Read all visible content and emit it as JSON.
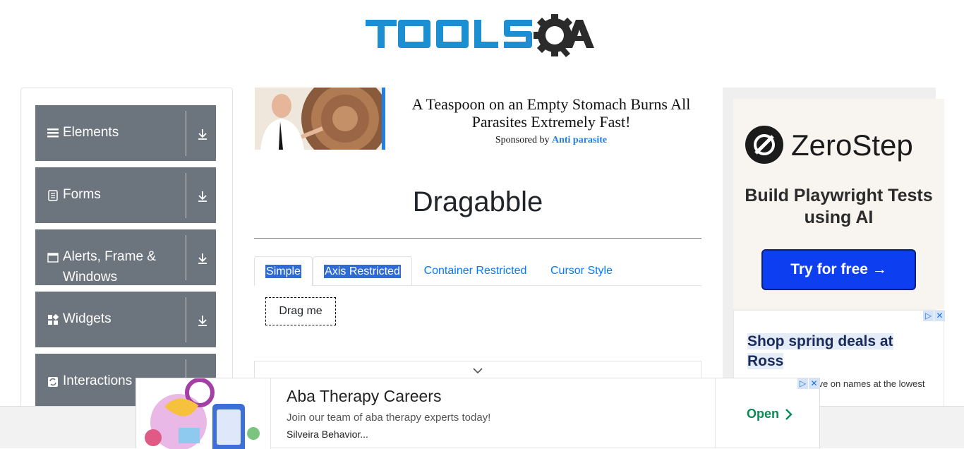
{
  "header": {
    "logo_text": "TOOLSQA"
  },
  "sidebar": {
    "groups": [
      {
        "label": "Elements",
        "icon": "hamburger-icon"
      },
      {
        "label": "Forms",
        "icon": "document-icon"
      },
      {
        "label": "Alerts, Frame & Windows",
        "icon": "window-icon"
      },
      {
        "label": "Widgets",
        "icon": "widgets-icon"
      },
      {
        "label": "Interactions",
        "icon": "interactions-icon"
      }
    ]
  },
  "top_ad": {
    "headline": "A Teaspoon on an Empty Stomach Burns All Parasites Extremely Fast!",
    "sponsored_by": "Sponsored by",
    "sponsor": "Anti parasite"
  },
  "main": {
    "title": "Dragabble",
    "tabs": [
      {
        "label": "Simple"
      },
      {
        "label": "Axis Restricted"
      },
      {
        "label": "Container Restricted"
      },
      {
        "label": "Cursor Style"
      }
    ],
    "drag_label": "Drag me"
  },
  "right_ad": {
    "brand": "ZeroStep",
    "tagline": "Build Playwright Tests using AI",
    "cta": "Try for free →"
  },
  "ross_ad": {
    "title": "Shop spring deals at Ross",
    "body": "o by Ross and save on names at the lowest"
  },
  "bottom_ad": {
    "title": "Aba Therapy Careers",
    "description": "Join our team of aba therapy experts today!",
    "advertiser": "Silveira Behavior...",
    "cta": "Open"
  },
  "colors": {
    "accent": "#007bff",
    "sidebar_group": "#6c757d",
    "cta_blue": "#0d3ef0",
    "open_green": "#0a8a56"
  }
}
